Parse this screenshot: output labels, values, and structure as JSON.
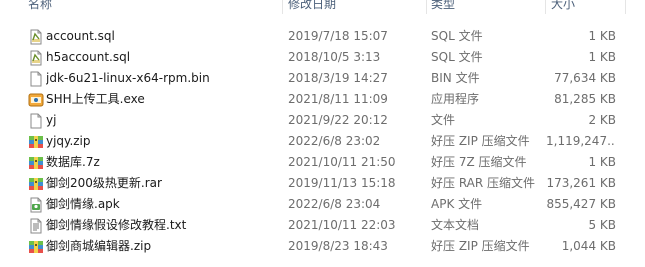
{
  "columns": {
    "name": "名称",
    "date": "修改日期",
    "type": "类型",
    "size": "大小"
  },
  "files": [
    {
      "name": "account.sql",
      "date": "2019/7/18 15:07",
      "type": "SQL 文件",
      "size": "1 KB",
      "icon": "sql-file-icon"
    },
    {
      "name": "h5account.sql",
      "date": "2018/10/5 3:13",
      "type": "SQL 文件",
      "size": "1 KB",
      "icon": "sql-file-icon"
    },
    {
      "name": "jdk-6u21-linux-x64-rpm.bin",
      "date": "2018/3/19 14:27",
      "type": "BIN 文件",
      "size": "77,634 KB",
      "icon": "blank-file-icon"
    },
    {
      "name": "SHH上传工具.exe",
      "date": "2021/8/11 11:09",
      "type": "应用程序",
      "size": "81,285 KB",
      "icon": "exe-app-icon"
    },
    {
      "name": "yj",
      "date": "2021/9/22 20:12",
      "type": "文件",
      "size": "2 KB",
      "icon": "blank-file-icon"
    },
    {
      "name": "yjqy.zip",
      "date": "2022/6/8 23:02",
      "type": "好压 ZIP 压缩文件",
      "size": "1,119,247...",
      "icon": "archive-icon"
    },
    {
      "name": "数据库.7z",
      "date": "2021/10/11 21:50",
      "type": "好压 7Z 压缩文件",
      "size": "1 KB",
      "icon": "archive-icon"
    },
    {
      "name": "御剑200级热更新.rar",
      "date": "2019/11/13 15:18",
      "type": "好压 RAR 压缩文件",
      "size": "173,261 KB",
      "icon": "archive-icon"
    },
    {
      "name": "御剑情缘.apk",
      "date": "2022/6/8 23:04",
      "type": "APK 文件",
      "size": "855,427 KB",
      "icon": "apk-file-icon"
    },
    {
      "name": "御剑情缘假设修改教程.txt",
      "date": "2021/10/11 22:03",
      "type": "文本文档",
      "size": "5 KB",
      "icon": "text-file-icon"
    },
    {
      "name": "御剑商城编辑器.zip",
      "date": "2019/8/23 18:43",
      "type": "好压 ZIP 压缩文件",
      "size": "1,044 KB",
      "icon": "archive-icon"
    }
  ]
}
